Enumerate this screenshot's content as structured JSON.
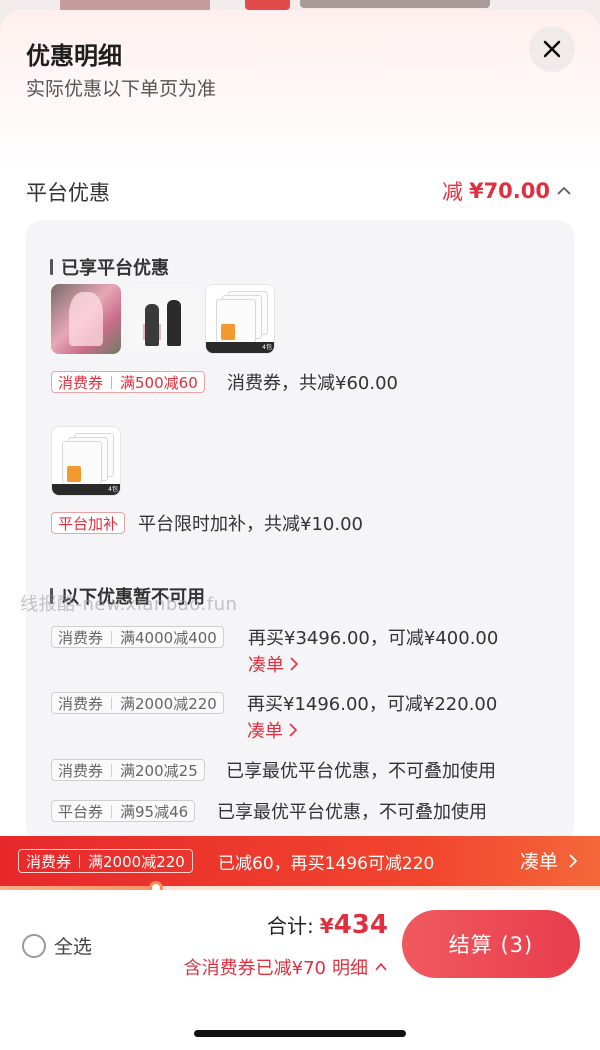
{
  "sheet": {
    "title": "优惠明细",
    "subtitle": "实际优惠以下单页为准"
  },
  "platform_discount": {
    "label": "平台优惠",
    "prefix": "减",
    "amount": "¥70.00"
  },
  "enjoyed": {
    "heading": "已享平台优惠",
    "coupon": {
      "type": "消费券",
      "rule": "满500减60",
      "desc": "消费券，共减¥60.00"
    },
    "subsidy": {
      "type": "平台加补",
      "desc": "平台限时加补，共减¥10.00"
    },
    "package_count": "4包"
  },
  "unavailable": {
    "heading": "以下优惠暂不可用",
    "items": [
      {
        "type": "消费券",
        "rule": "满4000减400",
        "desc": "再买¥3496.00，可减¥400.00",
        "link": "凑单"
      },
      {
        "type": "消费券",
        "rule": "满2000减220",
        "desc": "再买¥1496.00，可减¥220.00",
        "link": "凑单"
      },
      {
        "type": "消费券",
        "rule": "满200减25",
        "desc": "已享最优平台优惠，不可叠加使用"
      },
      {
        "type": "平台券",
        "rule": "满95减46",
        "desc": "已享最优平台优惠，不可叠加使用"
      }
    ]
  },
  "watermark": "线报酷-new.xianbao.fun",
  "promo_bar": {
    "type": "消费券",
    "rule": "满2000减220",
    "text": "已减60，再买1496可减220",
    "action": "凑单",
    "progress": 0.26
  },
  "footer": {
    "select_all": "全选",
    "total_label": "合计:",
    "currency": "¥",
    "total_value": "434",
    "coupon_note": "含消费券已减¥70",
    "detail_label": "明细",
    "checkout_label": "结算 (3)"
  },
  "colors": {
    "accent": "#e0303f",
    "promo_bar": "#e7282b",
    "checkout": "#ec4c57"
  }
}
